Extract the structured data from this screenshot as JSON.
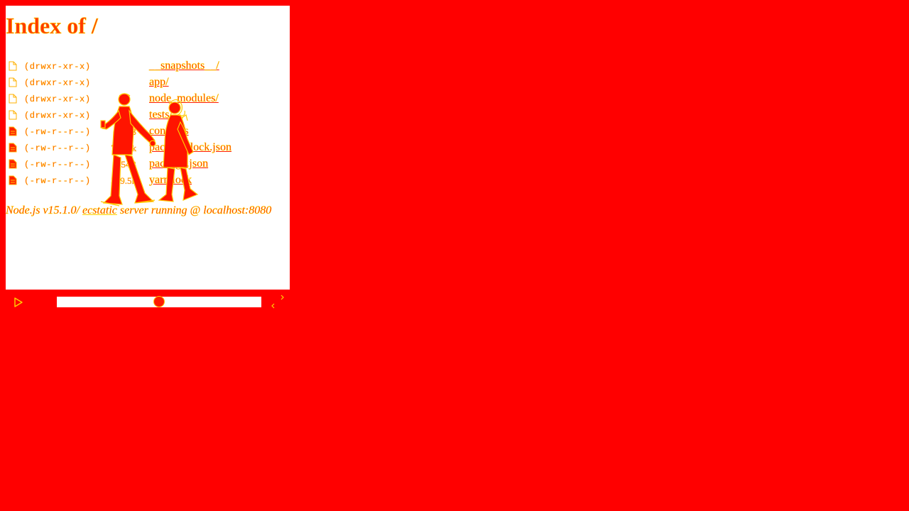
{
  "page": {
    "title": "Index of /"
  },
  "listing": [
    {
      "perm": "(drwxr-xr-x)",
      "size": "",
      "name": "__snapshots__/",
      "icon": "folder-icon"
    },
    {
      "perm": "(drwxr-xr-x)",
      "size": "",
      "name": "app/",
      "icon": "folder-icon"
    },
    {
      "perm": "(drwxr-xr-x)",
      "size": "",
      "name": "node_modules/",
      "icon": "folder-icon"
    },
    {
      "perm": "(drwxr-xr-x)",
      "size": "",
      "name": "tests/",
      "icon": "folder-icon"
    },
    {
      "perm": "(-rw-r--r--)",
      "size": "611B",
      "name": "config.js",
      "icon": "file-icon"
    },
    {
      "perm": "(-rw-r--r--)",
      "size": "774.7k",
      "name": "package-lock.json",
      "icon": "file-icon"
    },
    {
      "perm": "(-rw-r--r--)",
      "size": "654B",
      "name": "package.json",
      "icon": "file-icon"
    },
    {
      "perm": "(-rw-r--r--)",
      "size": "399.5k",
      "name": "yarn.lock",
      "icon": "file-icon"
    }
  ],
  "footer": {
    "prefix": "Node.js v15.1.0/ ",
    "link": "ecstatic",
    "suffix": " server running @ localhost:8080"
  },
  "controls": {
    "slider_value": 0.5,
    "play_icon": "play-icon",
    "swap_icon": "swap-arrows-icon"
  },
  "colors": {
    "background": "#ff0000",
    "panel": "#ffffff",
    "accent": "#ffd400"
  }
}
